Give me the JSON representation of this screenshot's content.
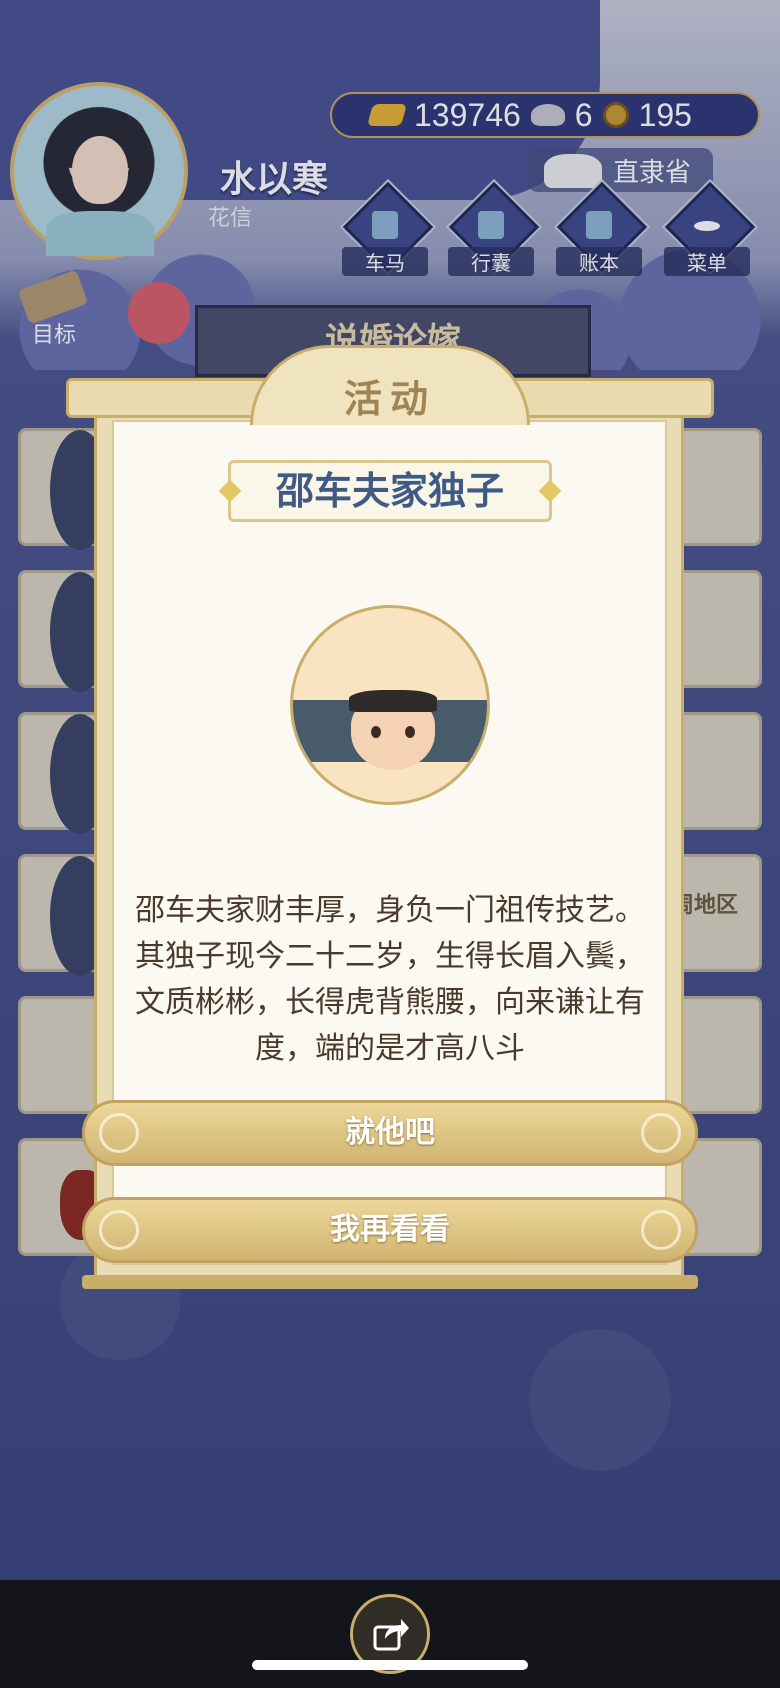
{
  "player": {
    "name": "水以寒",
    "title": "花信"
  },
  "currency": {
    "gold": "139746",
    "silver": "6",
    "coin": "195"
  },
  "location": "直隶省",
  "top_buttons": [
    {
      "label": "车马",
      "icon": "carriage-icon"
    },
    {
      "label": "行囊",
      "icon": "bag-icon"
    },
    {
      "label": "账本",
      "icon": "ledger-icon"
    },
    {
      "label": "菜单",
      "icon": "menu-icon"
    }
  ],
  "goal_label": "目标",
  "banner_behind": "说婚论嫁",
  "card_behind_text": "周地区",
  "dialog": {
    "header": "活动",
    "candidate_name": "邵车夫家独子",
    "description": "邵车夫家财丰厚，身负一门祖传技艺。其独子现今二十二岁，生得长眉入鬓，文质彬彬，长得虎背熊腰，向来谦让有度，端的是才高八斗",
    "accept_label": "就他吧",
    "decline_label": "我再看看"
  },
  "colors": {
    "navy": "#3d4780",
    "gold": "#c9ae6a",
    "name_blue": "#3e5a85"
  }
}
